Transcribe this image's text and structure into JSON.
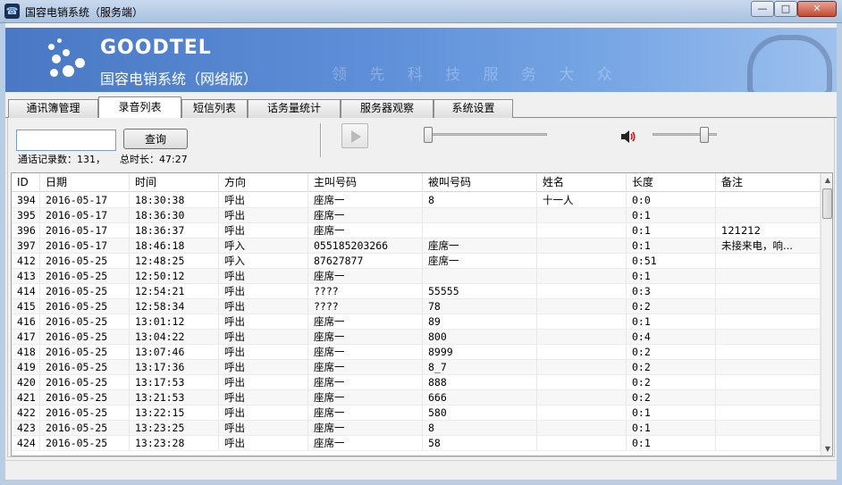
{
  "window": {
    "title": "国容电销系统（服务端）",
    "minimize_glyph": "—",
    "maximize_glyph": "□",
    "close_glyph": "✕",
    "app_icon_glyph": "☎"
  },
  "banner": {
    "logo": "GOODTEL",
    "product_name": "国容电销系统（网络版）",
    "slogan": "领 先 科 技    服 务 大 众"
  },
  "tabs": [
    {
      "label": "通讯簿管理",
      "active": false
    },
    {
      "label": "录音列表",
      "active": true
    },
    {
      "label": "短信列表",
      "active": false
    },
    {
      "label": "话务量统计",
      "active": false
    },
    {
      "label": "服务器观察",
      "active": false
    },
    {
      "label": "系统设置",
      "active": false
    }
  ],
  "toolbar": {
    "search_value": "",
    "query_label": "查询",
    "record_count": "通话记录数：131，",
    "total_duration": "总时长：47:27",
    "position_fraction": 0.0,
    "volume_fraction": 0.85
  },
  "table": {
    "headers": [
      "ID",
      "日期",
      "时间",
      "方向",
      "主叫号码",
      "被叫号码",
      "姓名",
      "长度",
      "备注"
    ],
    "rows": [
      [
        "394",
        "2016-05-17",
        "18:30:38",
        "呼出",
        "座席一",
        "8",
        "十一人",
        "0:0",
        ""
      ],
      [
        "395",
        "2016-05-17",
        "18:36:30",
        "呼出",
        "座席一",
        "",
        "",
        "0:1",
        ""
      ],
      [
        "396",
        "2016-05-17",
        "18:36:37",
        "呼出",
        "座席一",
        "",
        "",
        "0:1",
        "121212"
      ],
      [
        "397",
        "2016-05-17",
        "18:46:18",
        "呼入",
        "055185203266",
        "座席一",
        "",
        "0:1",
        "未接来电，响..."
      ],
      [
        "412",
        "2016-05-25",
        "12:48:25",
        "呼入",
        "87627877",
        "座席一",
        "",
        "0:51",
        ""
      ],
      [
        "413",
        "2016-05-25",
        "12:50:12",
        "呼出",
        "座席一",
        "",
        "",
        "0:1",
        ""
      ],
      [
        "414",
        "2016-05-25",
        "12:54:21",
        "呼出",
        "????",
        "55555",
        "",
        "0:3",
        ""
      ],
      [
        "415",
        "2016-05-25",
        "12:58:34",
        "呼出",
        "????",
        "78",
        "",
        "0:2",
        ""
      ],
      [
        "416",
        "2016-05-25",
        "13:01:12",
        "呼出",
        "座席一",
        "89",
        "",
        "0:1",
        ""
      ],
      [
        "417",
        "2016-05-25",
        "13:04:22",
        "呼出",
        "座席一",
        "800",
        "",
        "0:4",
        ""
      ],
      [
        "418",
        "2016-05-25",
        "13:07:46",
        "呼出",
        "座席一",
        "8999",
        "",
        "0:2",
        ""
      ],
      [
        "419",
        "2016-05-25",
        "13:17:36",
        "呼出",
        "座席一",
        "8_7",
        "",
        "0:2",
        ""
      ],
      [
        "420",
        "2016-05-25",
        "13:17:53",
        "呼出",
        "座席一",
        "888",
        "",
        "0:2",
        ""
      ],
      [
        "421",
        "2016-05-25",
        "13:21:53",
        "呼出",
        "座席一",
        "666",
        "",
        "0:2",
        ""
      ],
      [
        "422",
        "2016-05-25",
        "13:22:15",
        "呼出",
        "座席一",
        "580",
        "",
        "0:1",
        ""
      ],
      [
        "423",
        "2016-05-25",
        "13:23:25",
        "呼出",
        "座席一",
        "8",
        "",
        "0:1",
        ""
      ],
      [
        "424",
        "2016-05-25",
        "13:23:28",
        "呼出",
        "座席一",
        "58",
        "",
        "0:1",
        ""
      ]
    ]
  },
  "scrollbar": {
    "up_glyph": "▲",
    "down_glyph": "▼"
  }
}
